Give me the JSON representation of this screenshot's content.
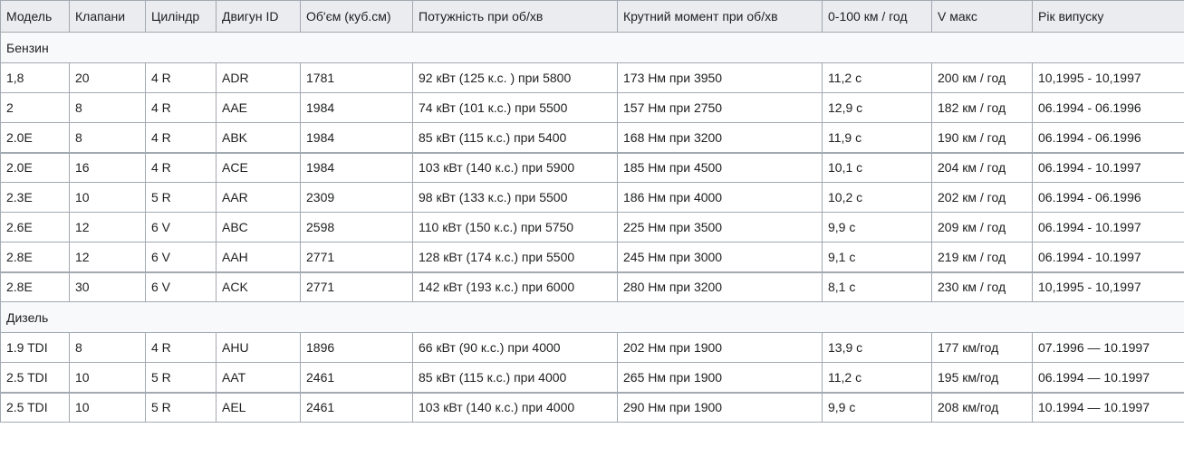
{
  "table": {
    "headers": [
      "Модель",
      "Клапани",
      "Циліндр",
      "Двигун ID",
      "Об'єм (куб.см)",
      "Потужність при об/хв",
      "Крутний момент при об/хв",
      "0-100 км / год",
      "V макс",
      "Рік випуску"
    ],
    "sections": [
      {
        "title": "Бензин",
        "rows": [
          [
            "1,8",
            "20",
            "4 R",
            "ADR",
            "1781",
            "92 кВт (125 к.с. ) при 5800",
            "173 Нм при 3950",
            "11,2 с",
            "200 км / год",
            "10,1995 - 10,1997"
          ],
          [
            "2",
            "8",
            "4 R",
            "AAE",
            "1984",
            "74 кВт (101 к.с.) при 5500",
            "157 Нм при 2750",
            "12,9 с",
            "182 км / год",
            "06.1994 - 06.1996"
          ],
          [
            "2.0E",
            "8",
            "4 R",
            "ABK",
            "1984",
            "85 кВт (115 к.с.) при 5400",
            "168 Нм при 3200",
            "11,9 с",
            "190 км / год",
            "06.1994 - 06.1996"
          ],
          [
            "2.0E",
            "16",
            "4 R",
            "ACE",
            "1984",
            "103 кВт (140 к.с.) при 5900",
            "185 Нм при 4500",
            "10,1 с",
            "204 км / год",
            "06.1994 - 10.1997"
          ],
          [
            "2.3E",
            "10",
            "5 R",
            "AAR",
            "2309",
            "98 кВт (133 к.с.) при 5500",
            "186 Нм при 4000",
            "10,2 с",
            "202 км / год",
            "06.1994 - 06.1996"
          ],
          [
            "2.6E",
            "12",
            "6 V",
            "ABC",
            "2598",
            "110 кВт (150 к.с.) при 5750",
            "225 Нм при 3500",
            "9,9 с",
            "209 км / год",
            "06.1994 - 10.1997"
          ],
          [
            "2.8E",
            "12",
            "6 V",
            "AAH",
            "2771",
            "128 кВт (174 к.с.) при 5500",
            "245 Нм при 3000",
            "9,1 с",
            "219 км / год",
            "06.1994 - 10.1997"
          ],
          [
            "2.8E",
            "30",
            "6 V",
            "ACK",
            "2771",
            "142 кВт (193 к.с.) при 6000",
            "280 Нм при 3200",
            "8,1 с",
            "230 км / год",
            "10,1995 - 10,1997"
          ]
        ]
      },
      {
        "title": "Дизель",
        "rows": [
          [
            "1.9 TDI",
            "8",
            "4 R",
            "AHU",
            "1896",
            "66 кВт (90 к.с.) при 4000",
            "202 Нм при 1900",
            "13,9 с",
            "177 км/год",
            "07.1996 — 10.1997"
          ],
          [
            "2.5 TDI",
            "10",
            "5 R",
            "AAT",
            "2461",
            "85 кВт (115 к.с.) при 4000",
            "265 Нм при 1900",
            "11,2 с",
            "195 км/год",
            "06.1994 — 10.1997"
          ],
          [
            "2.5 TDI",
            "10",
            "5 R",
            "AEL",
            "2461",
            "103 кВт (140 к.с.) при 4000",
            "290 Нм при 1900",
            "9,9 с",
            "208 км/год",
            "10.1994 — 10.1997"
          ]
        ]
      }
    ]
  }
}
